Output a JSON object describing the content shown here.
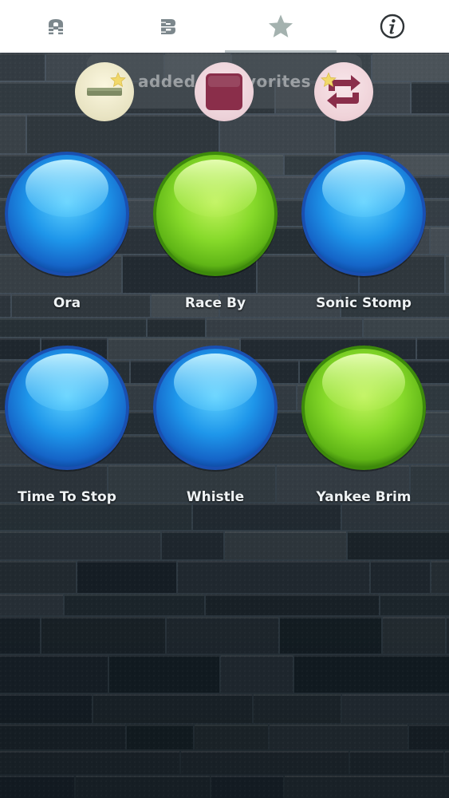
{
  "tabs": [
    {
      "label": "A",
      "icon": "letter-a-icon",
      "active": false
    },
    {
      "label": "B",
      "icon": "letter-b-icon",
      "active": false
    },
    {
      "label": "Favorites",
      "icon": "star-icon",
      "active": true
    },
    {
      "label": "Info",
      "icon": "info-icon",
      "active": false
    }
  ],
  "toast": {
    "text": "added to favorites"
  },
  "toolbar": [
    {
      "icon": "minus-icon",
      "badge": "star-icon"
    },
    {
      "icon": "stop-icon",
      "badge": null
    },
    {
      "icon": "repeat-icon",
      "badge": "star-icon"
    }
  ],
  "sounds": [
    {
      "label": "Ora",
      "color": "blue"
    },
    {
      "label": "Race By",
      "color": "green"
    },
    {
      "label": "Sonic Stomp",
      "color": "blue"
    },
    {
      "label": "Time To Stop",
      "color": "blue"
    },
    {
      "label": "Whistle",
      "color": "blue"
    },
    {
      "label": "Yankee Brim",
      "color": "green"
    }
  ],
  "colors": {
    "tab_icon": "#7c878c",
    "active_tab_icon": "#a4b2af",
    "blue_ball": "#1e88e5",
    "green_ball": "#7ed321",
    "stop_square": "#8a2e4a"
  }
}
